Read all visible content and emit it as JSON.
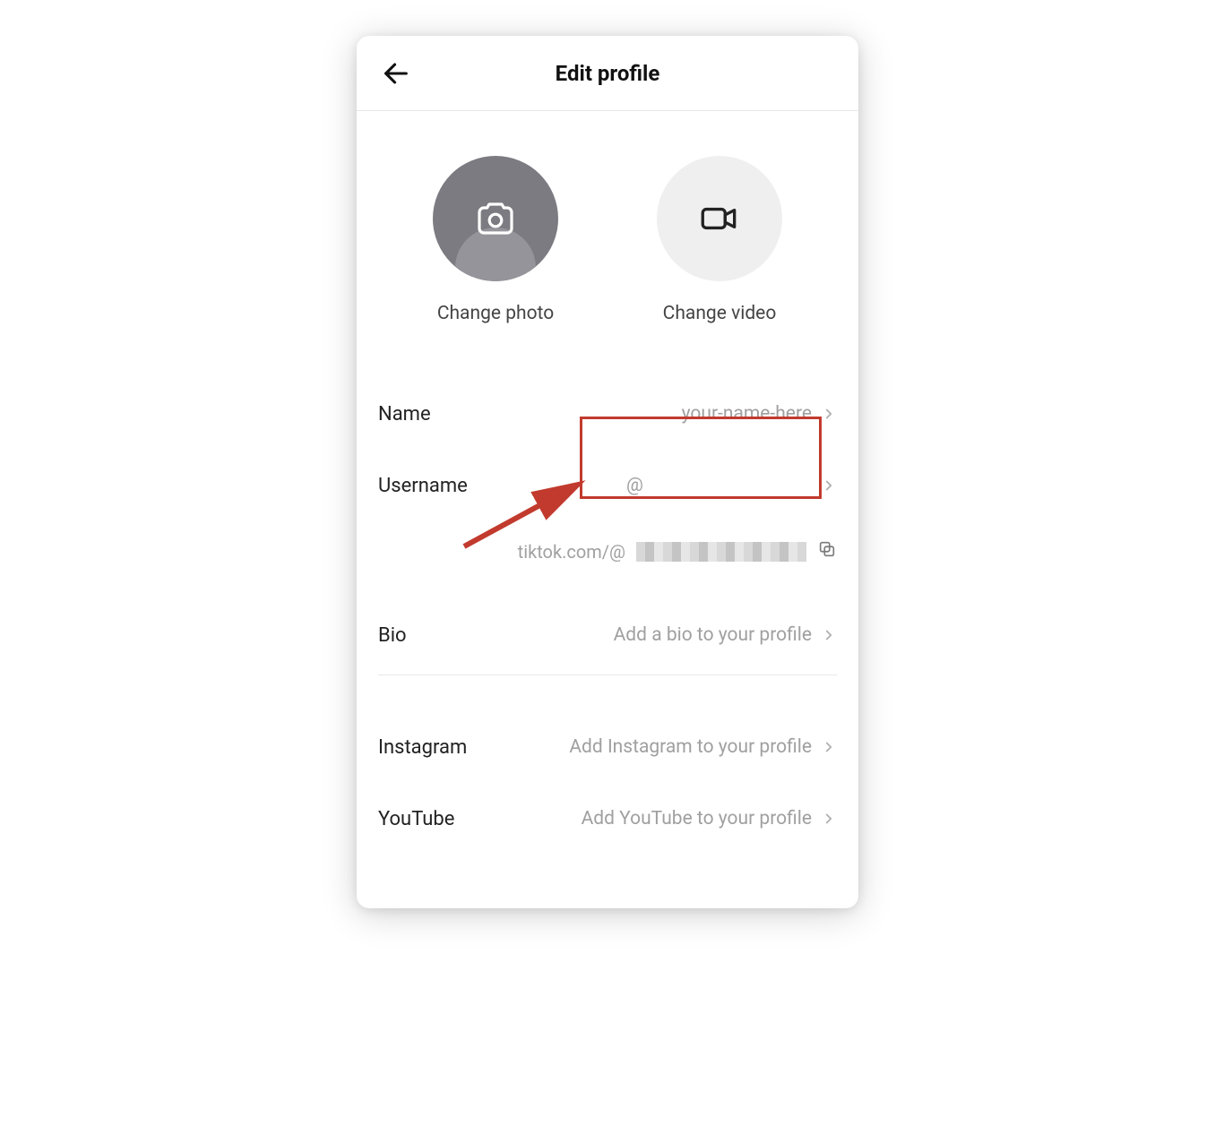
{
  "header": {
    "title": "Edit profile"
  },
  "media": {
    "photo_label": "Change photo",
    "video_label": "Change video"
  },
  "fields": {
    "name": {
      "label": "Name",
      "value": "your-name-here"
    },
    "username": {
      "label": "Username",
      "value": "@"
    },
    "url_prefix": "tiktok.com/@",
    "bio": {
      "label": "Bio",
      "placeholder": "Add a bio to your profile"
    },
    "instagram": {
      "label": "Instagram",
      "placeholder": "Add Instagram to your profile"
    },
    "youtube": {
      "label": "YouTube",
      "placeholder": "Add YouTube to your profile"
    }
  },
  "annotation": {
    "highlight_target": "username-value",
    "arrow_color": "#c23a2e"
  }
}
